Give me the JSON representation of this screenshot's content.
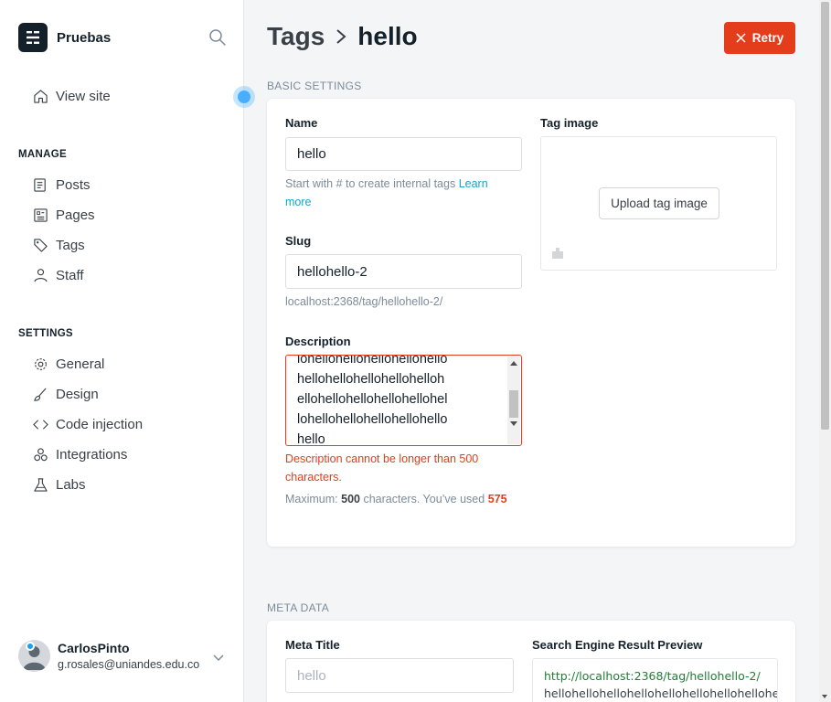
{
  "app": {
    "site_name": "Pruebas"
  },
  "sidebar": {
    "view_site": "View site",
    "manage_label": "MANAGE",
    "manage_items": [
      {
        "label": "Posts",
        "icon": "posts-icon"
      },
      {
        "label": "Pages",
        "icon": "pages-icon"
      },
      {
        "label": "Tags",
        "icon": "tag-icon"
      },
      {
        "label": "Staff",
        "icon": "staff-icon"
      }
    ],
    "settings_label": "SETTINGS",
    "settings_items": [
      {
        "label": "General",
        "icon": "gear-icon"
      },
      {
        "label": "Design",
        "icon": "brush-icon"
      },
      {
        "label": "Code injection",
        "icon": "code-icon"
      },
      {
        "label": "Integrations",
        "icon": "integrations-icon"
      },
      {
        "label": "Labs",
        "icon": "flask-icon"
      }
    ],
    "user": {
      "name": "CarlosPinto",
      "email": "g.rosales@uniandes.edu.co"
    }
  },
  "header": {
    "breadcrumb_parent": "Tags",
    "breadcrumb_current": "hello",
    "retry_label": "Retry"
  },
  "basic_settings": {
    "label": "BASIC SETTINGS",
    "name_label": "Name",
    "name_value": "hello",
    "name_hint": "Start with # to create internal tags",
    "learn": "Learn",
    "more": "more",
    "slug_label": "Slug",
    "slug_value": "hellohello-2",
    "slug_url": "localhost:2368/tag/hellohello-2/",
    "description_label": "Description",
    "description_lines": [
      "lohellohellohellohellohello",
      "hellohellohellohellohelloh",
      "ellohellohellohellohellohel",
      "lohellohellohellohellohello",
      "hello"
    ],
    "description_error_1": "Description cannot be longer than 500",
    "description_error_2": "characters.",
    "counter_prefix": "Maximum:",
    "counter_max": "500",
    "counter_mid": "characters. You’ve used",
    "counter_used": "575",
    "tag_image_label": "Tag image",
    "upload_label": "Upload tag image"
  },
  "meta_data": {
    "label": "META DATA",
    "meta_title_label": "Meta Title",
    "meta_title_placeholder": "hello",
    "preview_label": "Search Engine Result Preview",
    "preview_url": "http://localhost:2368/tag/hellohello-2/",
    "preview_title": "hellohellohellohellohellohellohellohellohe"
  },
  "colors": {
    "accent_error": "#e33d1c",
    "link": "#14a3d1",
    "serp_url": "#1e7e34"
  }
}
